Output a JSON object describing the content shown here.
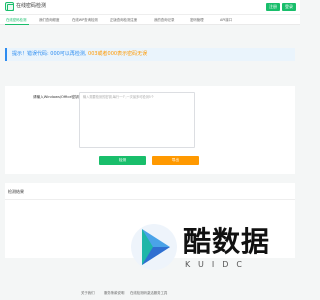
{
  "header": {
    "brand": "在线密码检测",
    "login_label": "注册",
    "register_label": "登录"
  },
  "tabs": [
    {
      "label": "在线密码检测"
    },
    {
      "label": "我们查询频度"
    },
    {
      "label": "在线WP查询检测"
    },
    {
      "label": "正版查询检测注册"
    },
    {
      "label": "我的查询记录"
    },
    {
      "label": "密码管理"
    },
    {
      "label": "API接口"
    }
  ],
  "notice": {
    "text": "提示！错误代码: 000可以再检测,",
    "warn": " 003或者000表示密码无误"
  },
  "form": {
    "field_label": "请输入Windows/Office密钥",
    "textarea_placeholder": "输入需要检测的密钥,每行一个,一次最多可检测5个",
    "query_label": "检测",
    "export_label": "导出"
  },
  "result": {
    "title": "检测结果"
  },
  "watermark": {
    "text": "酷数据",
    "sub": "KUIDC"
  },
  "footer": {
    "links": [
      "关于我们",
      "服务条款说明",
      "在线检测码激活服务工具"
    ]
  },
  "colors": {
    "accent": "#19be6b",
    "info": "#2d8cf0",
    "warning": "#ff9900"
  }
}
